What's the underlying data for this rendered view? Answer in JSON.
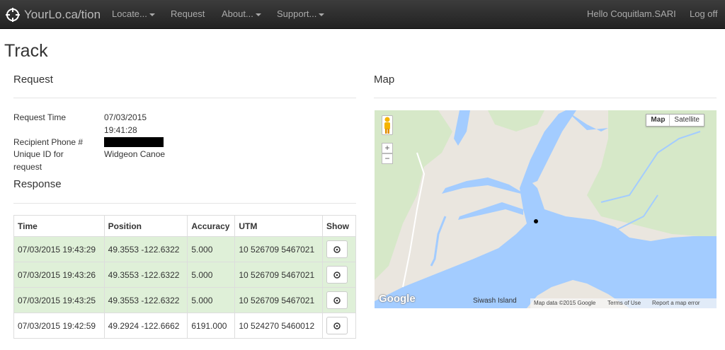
{
  "navbar": {
    "brand": "YourLo.ca/tion",
    "items": [
      {
        "label": "Locate..."
      },
      {
        "label": "Request"
      },
      {
        "label": "About..."
      },
      {
        "label": "Support..."
      }
    ],
    "greeting": "Hello Coquitlam.SARI",
    "logoff": "Log off"
  },
  "page": {
    "title": "Track"
  },
  "request": {
    "heading": "Request",
    "time_label": "Request Time",
    "time_date": "07/03/2015",
    "time_clock": "19:41:28",
    "phone_label": "Recipient Phone #",
    "uid_label_1": "Unique ID for",
    "uid_label_2": "request",
    "uid_value": "Widgeon Canoe"
  },
  "response": {
    "heading": "Response",
    "columns": [
      "Time",
      "Position",
      "Accuracy",
      "UTM",
      "Show"
    ],
    "rows": [
      {
        "time": "07/03/2015 19:43:29",
        "position": "49.3553 -122.6322",
        "accuracy": "5.000",
        "utm": "10 526709 5467021"
      },
      {
        "time": "07/03/2015 19:43:26",
        "position": "49.3553 -122.6322",
        "accuracy": "5.000",
        "utm": "10 526709 5467021"
      },
      {
        "time": "07/03/2015 19:43:25",
        "position": "49.3553 -122.6322",
        "accuracy": "5.000",
        "utm": "10 526709 5467021"
      },
      {
        "time": "07/03/2015 19:42:59",
        "position": "49.2924 -122.6662",
        "accuracy": "6191.000",
        "utm": "10 524270 5460012"
      }
    ],
    "row_states": [
      "success",
      "success",
      "success",
      "default"
    ],
    "show_icon": "crosshair-icon"
  },
  "map": {
    "heading": "Map",
    "type_map": "Map",
    "type_satellite": "Satellite",
    "zoom_in": "+",
    "zoom_out": "−",
    "place_label": "Siwash Island",
    "logo": "Google",
    "footer": {
      "data": "Map data ©2015 Google",
      "terms": "Terms of Use",
      "report": "Report a map error"
    }
  },
  "colors": {
    "navbar_bg": "#222222",
    "success_row": "#dff0d8",
    "water": "#a3ccff",
    "land": "#eae6df",
    "park": "#d6e8c8"
  }
}
